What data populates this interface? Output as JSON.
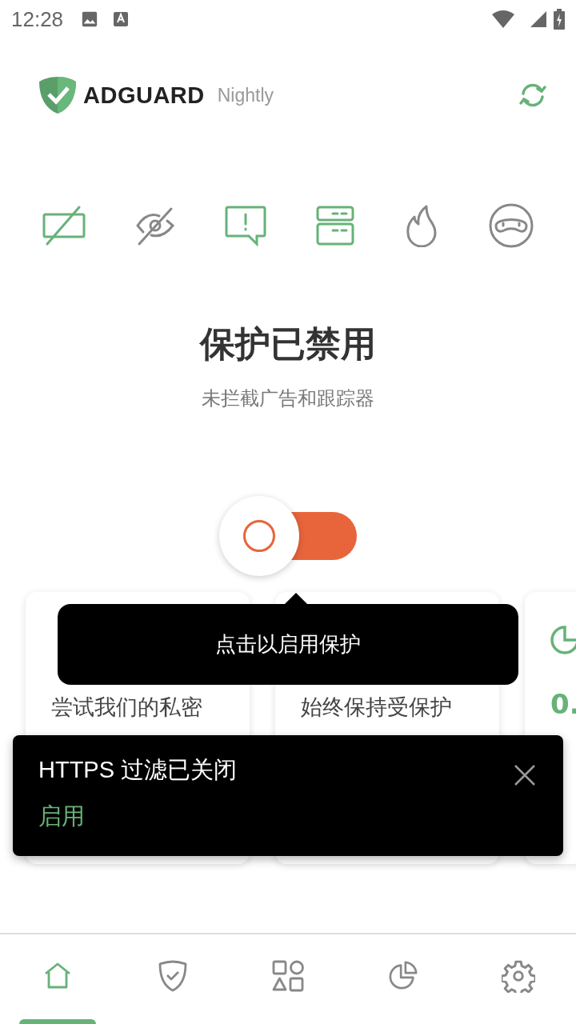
{
  "status_bar": {
    "time": "12:28"
  },
  "header": {
    "brand": "ADGUARD",
    "edition": "Nightly"
  },
  "features": [
    {
      "kind": "adblock",
      "on": true
    },
    {
      "kind": "stealth",
      "on": false
    },
    {
      "kind": "annoyance",
      "on": true
    },
    {
      "kind": "dns",
      "on": true
    },
    {
      "kind": "firewall",
      "on": false
    },
    {
      "kind": "ninja",
      "on": false
    }
  ],
  "protection": {
    "title": "保护已禁用",
    "subtitle": "未拦截广告和跟踪器",
    "on": false
  },
  "cards": [
    {
      "text": "尝试我们的私密"
    },
    {
      "text": "始终保持受保护"
    },
    {
      "value": "0."
    }
  ],
  "tooltip": {
    "text": "点击以启用保护"
  },
  "snackbar": {
    "message": "HTTPS 过滤已关闭",
    "action": "启用"
  },
  "nav": [
    {
      "kind": "home",
      "selected": true
    },
    {
      "kind": "protection",
      "selected": false
    },
    {
      "kind": "apps",
      "selected": false
    },
    {
      "kind": "stats",
      "selected": false
    },
    {
      "kind": "settings",
      "selected": false
    }
  ]
}
